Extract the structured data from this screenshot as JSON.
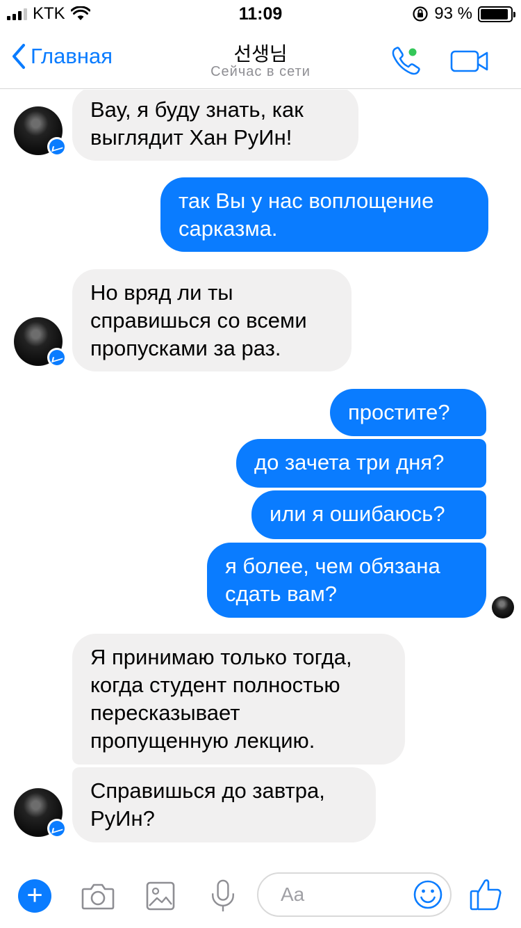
{
  "status_bar": {
    "carrier": "KTK",
    "time": "11:09",
    "battery_percent": "93 %",
    "battery_level": 0.93,
    "signal_bars_active": 3
  },
  "header": {
    "back_label": "Главная",
    "contact_name": "선생님",
    "contact_status": "Сейчас в сети",
    "online_dot_color": "#34c759"
  },
  "messages": [
    {
      "direction": "in",
      "text": "Вау, я буду знать, как\nвыглядит Хан РуИн!"
    },
    {
      "direction": "out",
      "text": "так Вы у нас воплощение\nсарказма."
    },
    {
      "direction": "in",
      "text": "Но вряд ли ты\nсправишься со всеми\nпропусками за раз."
    },
    {
      "direction": "out",
      "text": "простите?"
    },
    {
      "direction": "out",
      "text": "до зачета три дня?"
    },
    {
      "direction": "out",
      "text": "или я ошибаюсь?"
    },
    {
      "direction": "out",
      "text": "я более, чем обязана\nсдать вам?"
    },
    {
      "direction": "in",
      "text": "Я принимаю только тогда,\nкогда студент полностью\nпересказывает\nпропущенную лекцию."
    },
    {
      "direction": "in",
      "text": "Справишься до завтра,\nРуИн?"
    }
  ],
  "composer": {
    "placeholder": "Aa",
    "icons": [
      "plus-icon",
      "camera-icon",
      "photo-icon",
      "microphone-icon",
      "emoji-icon",
      "like-icon"
    ]
  },
  "colors": {
    "accent": "#0a7cff",
    "incoming_bubble": "#f1f0f0",
    "outgoing_text": "#ffffff"
  }
}
